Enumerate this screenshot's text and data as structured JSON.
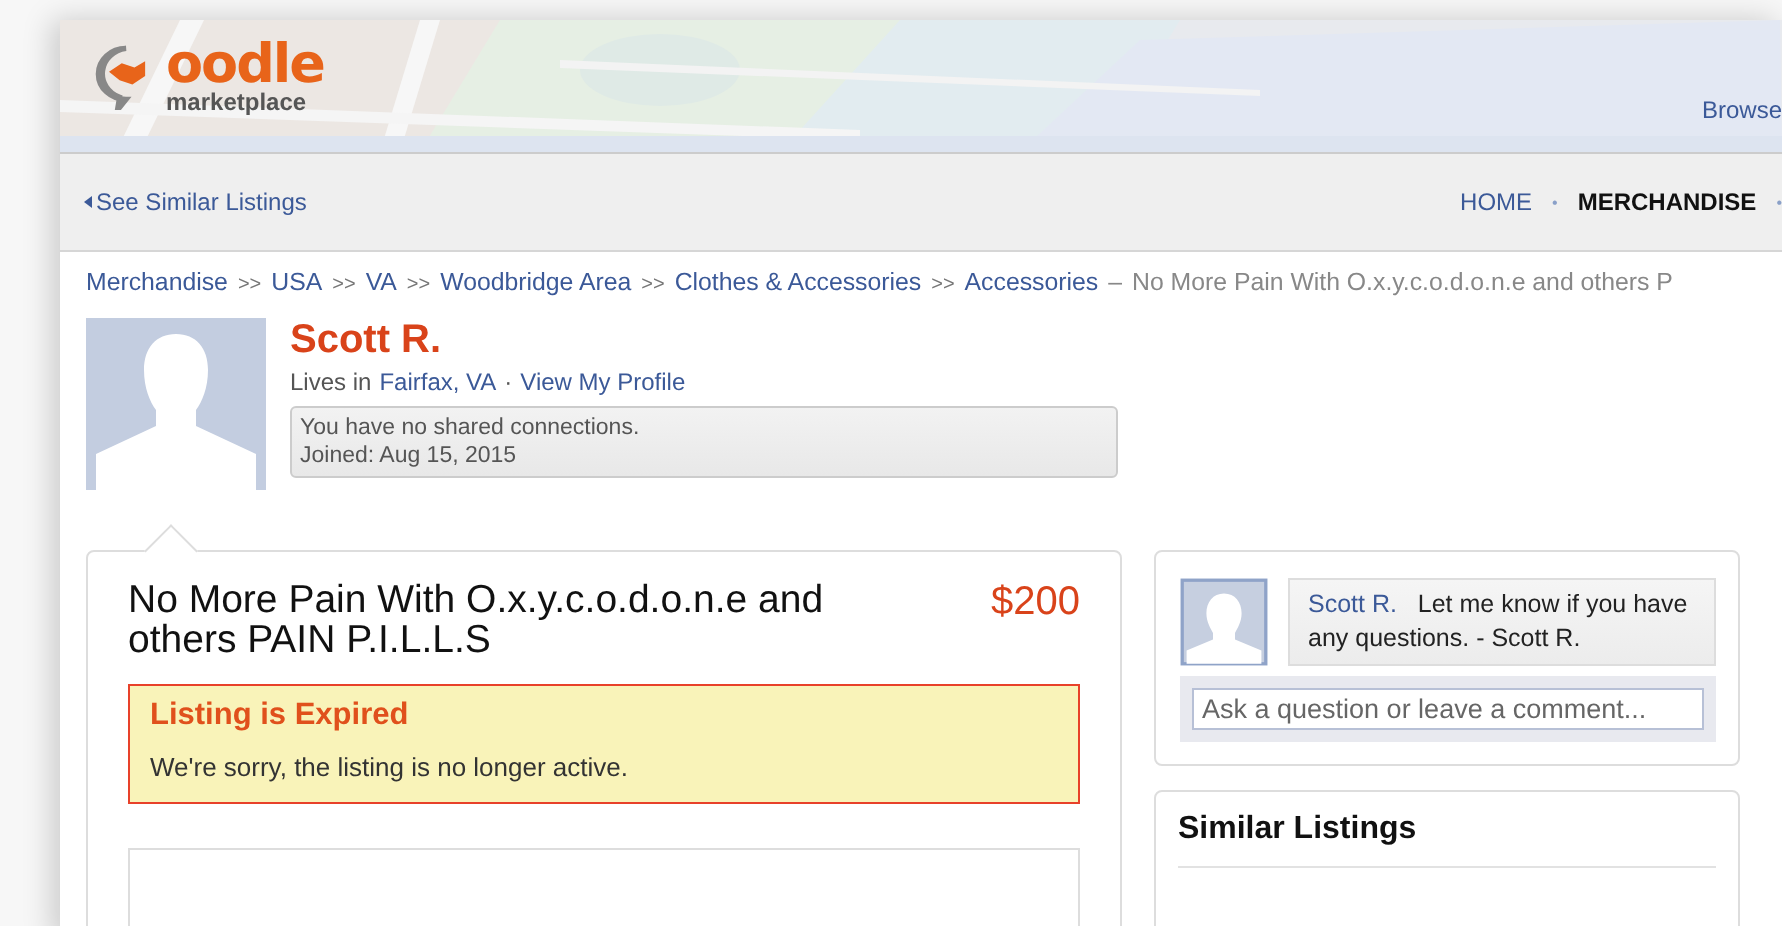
{
  "header": {
    "logo": {
      "name": "oodle",
      "tagline": "marketplace"
    },
    "browse_link": "Browse"
  },
  "nav": {
    "back_link": "See Similar Listings",
    "separator": "•",
    "items": [
      {
        "label": "HOME",
        "selected": false
      },
      {
        "label": "MERCHANDISE",
        "selected": true
      }
    ]
  },
  "breadcrumb": {
    "separator": ">>",
    "items": [
      "Merchandise",
      "USA",
      "VA",
      "Woodbridge Area",
      "Clothes & Accessories",
      "Accessories"
    ],
    "dash": "–",
    "current": "No More Pain With O.x.y.c.o.d.o.n.e and others P"
  },
  "seller": {
    "name": "Scott R.",
    "lives_in_label": "Lives in",
    "location": "Fairfax, VA",
    "dot": "·",
    "profile_link": "View My Profile",
    "connections": "You have no shared connections.",
    "joined": "Joined: Aug 15, 2015"
  },
  "listing": {
    "title": "No More Pain With O.x.y.c.o.d.o.n.e and others PAIN P.I.L.L.S",
    "price": "$200",
    "alert": {
      "title": "Listing is Expired",
      "message": "We're sorry, the listing is no longer active."
    }
  },
  "comments": {
    "author": "Scott R.",
    "message": "Let me know if you have any questions. - Scott R.",
    "input_placeholder": "Ask a question or leave a comment..."
  },
  "similar_listings": {
    "title": "Similar Listings"
  }
}
